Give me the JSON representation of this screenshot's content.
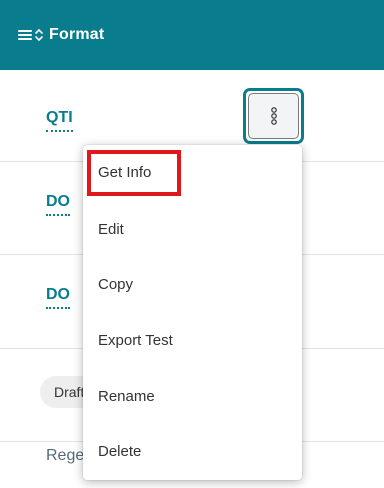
{
  "header": {
    "title": "Format",
    "background_color": "#097d8e",
    "icons": [
      "menu-icon",
      "sort-icon"
    ]
  },
  "rows": [
    {
      "link": "QTI"
    },
    {
      "link": "DO"
    },
    {
      "link": "DO"
    },
    {
      "chip": "Draft"
    },
    {
      "text": "Regenerate"
    }
  ],
  "kebab_button": {
    "icon": "vertical-ellipsis-icon",
    "accent_color": "#097d8e"
  },
  "context_menu": {
    "items": [
      {
        "label": "Get Info",
        "highlighted": true
      },
      {
        "label": "Edit"
      },
      {
        "label": "Copy"
      },
      {
        "label": "Export Test"
      },
      {
        "label": "Rename"
      },
      {
        "label": "Delete"
      }
    ],
    "highlight_color": "#e0181b"
  }
}
